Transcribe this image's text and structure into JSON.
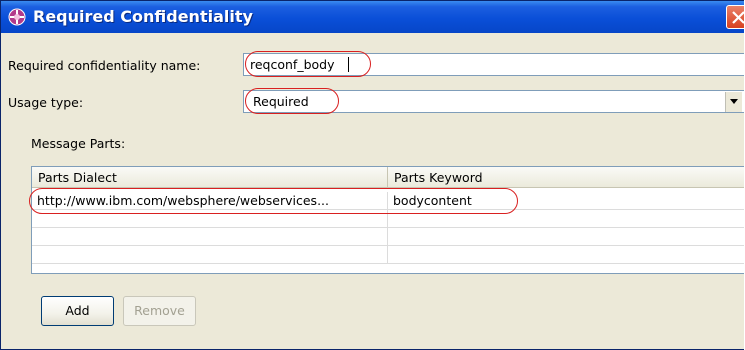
{
  "window": {
    "title": "Required Confidentiality",
    "title_icon": "policy-icon",
    "close_icon": "close-icon"
  },
  "form": {
    "name_label": "Required confidentiality name:",
    "name_value": "reqconf_body",
    "usage_label": "Usage type:",
    "usage_value": "Required",
    "usage_options": [
      "Required"
    ]
  },
  "message_parts": {
    "label": "Message Parts:",
    "columns": [
      "Parts Dialect",
      "Parts Keyword"
    ],
    "rows": [
      {
        "dialect": "http://www.ibm.com/websphere/webservices...",
        "keyword": "bodycontent"
      }
    ]
  },
  "buttons": {
    "add": "Add",
    "remove": "Remove"
  },
  "colors": {
    "title_bar": "#0a4fd8",
    "highlight": "#d92020",
    "dialog_bg": "#ece9d8"
  }
}
